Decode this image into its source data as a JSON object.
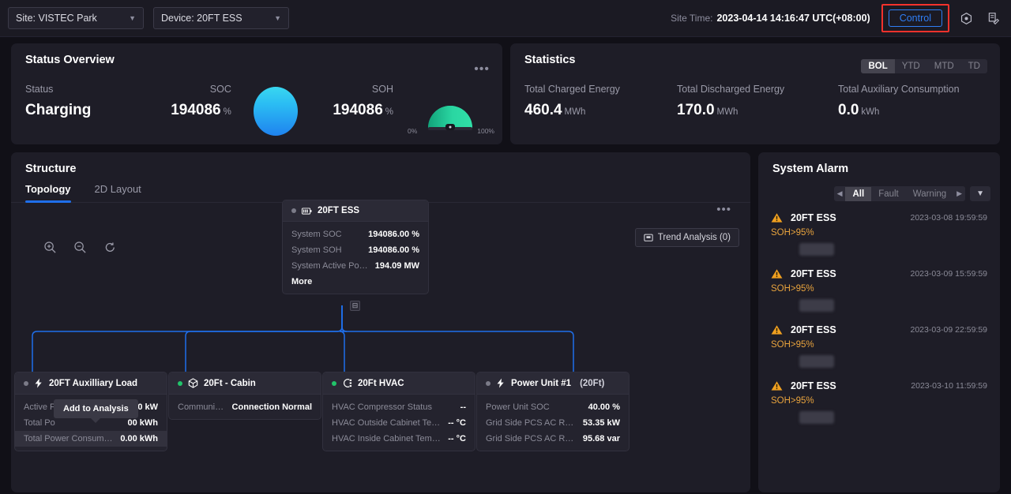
{
  "header": {
    "site_selector": "Site: VISTEC Park",
    "device_selector": "Device: 20FT ESS",
    "site_time_label": "Site Time:",
    "site_time_value": "2023-04-14 14:16:47 UTC(+08:00)",
    "control_button": "Control",
    "icons": [
      "target-settings-icon",
      "report-edit-icon"
    ],
    "highlight_color": "#f4322c",
    "accent_color": "#2f7ef5"
  },
  "status_overview": {
    "title": "Status Overview",
    "status_label": "Status",
    "status_value": "Charging",
    "soc_label": "SOC",
    "soc_value": "194086",
    "soc_unit": "%",
    "soh_label": "SOH",
    "soh_value": "194086",
    "soh_unit": "%",
    "gauge_min": "0%",
    "gauge_max": "100%",
    "more_dots": "•••"
  },
  "statistics": {
    "title": "Statistics",
    "ranges": [
      {
        "label": "BOL",
        "active": true
      },
      {
        "label": "YTD",
        "active": false
      },
      {
        "label": "MTD",
        "active": false
      },
      {
        "label": "TD",
        "active": false
      }
    ],
    "items": [
      {
        "label": "Total Charged Energy",
        "value": "460.4",
        "unit": "MWh"
      },
      {
        "label": "Total Discharged Energy",
        "value": "170.0",
        "unit": "MWh"
      },
      {
        "label": "Total Auxiliary Consumption",
        "value": "0.0",
        "unit": "kWh"
      }
    ]
  },
  "structure": {
    "title": "Structure",
    "tabs": [
      {
        "label": "Topology",
        "active": true
      },
      {
        "label": "2D Layout",
        "active": false
      }
    ],
    "zoom_controls": [
      "zoom-in-icon",
      "zoom-out-icon",
      "reset-view-icon"
    ],
    "more_dots": "•••",
    "trend_button": "Trend Analysis (0)",
    "tooltip": "Add to Analysis",
    "root_node": {
      "title": "20FT ESS",
      "icon": "battery-icon",
      "status": "grey",
      "rows": [
        {
          "key": "System SOC",
          "value": "194086.00 %"
        },
        {
          "key": "System SOH",
          "value": "194086.00 %"
        },
        {
          "key": "System Active Power (...",
          "value": "194.09 MW"
        }
      ],
      "more": "More"
    },
    "child_nodes": [
      {
        "title": "20FT Auxilliary Load",
        "icon": "bolt-icon",
        "status": "grey",
        "rows": [
          {
            "key": "Active Power",
            "value": "58.00 kW",
            "highlight": false
          },
          {
            "key": "Total Po",
            "value": "00 kWh",
            "highlight": false
          },
          {
            "key": "Total Power Consumpti...",
            "value": "0.00 kWh",
            "highlight": true
          }
        ]
      },
      {
        "title": "20Ft - Cabin",
        "icon": "cube-icon",
        "status": "green",
        "rows": [
          {
            "key": "Communicatio...",
            "value": "Connection Normal",
            "highlight": false
          }
        ]
      },
      {
        "title": "20Ft HVAC",
        "icon": "hvac-icon",
        "status": "green",
        "rows": [
          {
            "key": "HVAC Compressor Status",
            "value": "--",
            "highlight": false
          },
          {
            "key": "HVAC Outside Cabinet Tem...",
            "value": "-- °C",
            "highlight": false
          },
          {
            "key": "HVAC Inside Cabinet Temp...",
            "value": "-- °C",
            "highlight": false
          }
        ]
      },
      {
        "title": "Power Unit #1",
        "subtitle": "(20Ft)",
        "icon": "bolt-icon",
        "status": "grey",
        "rows": [
          {
            "key": "Power Unit SOC",
            "value": "40.00 %",
            "highlight": false
          },
          {
            "key": "Grid Side PCS AC Real ...",
            "value": "53.35 kW",
            "highlight": false
          },
          {
            "key": "Grid Side PCS AC Reac...",
            "value": "95.68 var",
            "highlight": false
          }
        ]
      }
    ]
  },
  "system_alarm": {
    "title": "System Alarm",
    "filters": [
      {
        "label": "All",
        "active": true
      },
      {
        "label": "Fault",
        "active": false
      },
      {
        "label": "Warning",
        "active": false
      }
    ],
    "prev_arrow": "◀",
    "next_arrow": "▶",
    "dropdown_icon": "chevron-down-icon",
    "items": [
      {
        "device": "20FT ESS",
        "time": "2023-03-08 19:59:59",
        "message": "SOH>95%"
      },
      {
        "device": "20FT ESS",
        "time": "2023-03-09 15:59:59",
        "message": "SOH>95%"
      },
      {
        "device": "20FT ESS",
        "time": "2023-03-09 22:59:59",
        "message": "SOH>95%"
      },
      {
        "device": "20FT ESS",
        "time": "2023-03-10 11:59:59",
        "message": "SOH>95%"
      }
    ]
  }
}
